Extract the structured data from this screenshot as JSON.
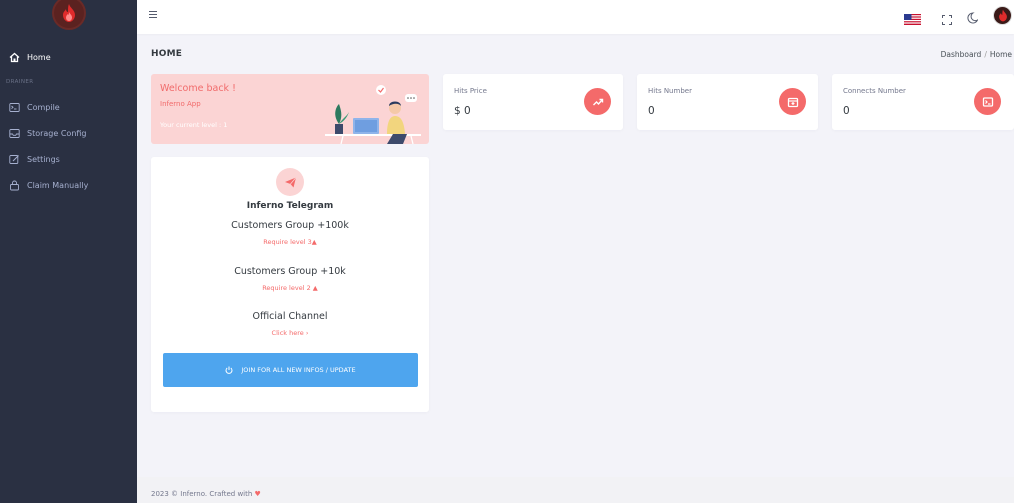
{
  "sidebar": {
    "items": [
      {
        "label": "Home",
        "icon": "home-icon",
        "active": true
      },
      {
        "section": "DRAINER"
      },
      {
        "label": "Compile",
        "icon": "terminal-icon"
      },
      {
        "label": "Storage Config",
        "icon": "inbox-icon"
      },
      {
        "label": "Settings",
        "icon": "edit-icon"
      },
      {
        "label": "Claim Manually",
        "icon": "lock-icon"
      }
    ]
  },
  "header": {
    "page_title": "HOME",
    "breadcrumb": [
      "Dashboard",
      "Home"
    ]
  },
  "welcome": {
    "title": "Welcome back !",
    "subtitle": "Inferno App",
    "level_text": "Your current level : 1"
  },
  "stats": [
    {
      "label": "Hits Price",
      "value": "$ 0",
      "icon": "trending-up-icon"
    },
    {
      "label": "Hits Number",
      "value": "0",
      "icon": "box-icon"
    },
    {
      "label": "Connects Number",
      "value": "0",
      "icon": "terminal-icon"
    }
  ],
  "telegram": {
    "heading": "Inferno Telegram",
    "groups": [
      {
        "title": "Customers Group +100k",
        "sub": "Require level 3"
      },
      {
        "title": "Customers Group +10k",
        "sub": "Require level 2"
      },
      {
        "title": "Official Channel",
        "sub": "Click here"
      }
    ],
    "button_label": "JOIN FOR ALL NEW INFOS / UPDATE"
  },
  "footer": {
    "text": "2023 © Inferno. Crafted with"
  },
  "colors": {
    "sidebar_bg": "#2a3042",
    "accent_red": "#f46a6a",
    "button_blue": "#4ea5ee",
    "welcome_bg": "#fbd4d4"
  }
}
